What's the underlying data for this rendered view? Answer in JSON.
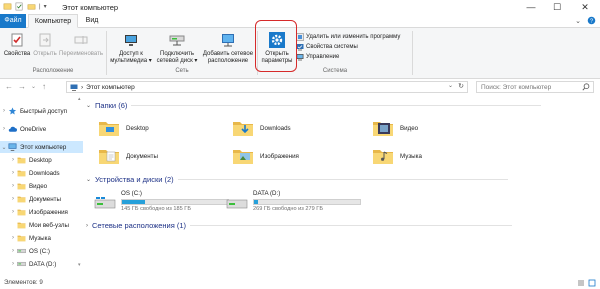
{
  "window": {
    "title": "Этот компьютер",
    "minimize": "—",
    "maximize": "☐",
    "close": "✕"
  },
  "ribbon_tabs": {
    "file": "Файл",
    "computer": "Компьютер",
    "view": "Вид"
  },
  "ribbon": {
    "location_group": {
      "label": "Расположение",
      "properties": "Свойства",
      "open": "Открыть",
      "rename": "Переименовать"
    },
    "network_group": {
      "label": "Сеть",
      "media_access_line1": "Доступ к",
      "media_access_line2": "мультимедиа ▾",
      "map_drive_line1": "Подключить",
      "map_drive_line2": "сетевой диск ▾",
      "add_location_line1": "Добавить сетевое",
      "add_location_line2": "расположение"
    },
    "system_group": {
      "label": "Система",
      "open_settings_line1": "Открыть",
      "open_settings_line2": "параметры",
      "uninstall": "Удалить или изменить программу",
      "system_properties": "Свойства системы",
      "manage": "Управление"
    }
  },
  "address_bar": {
    "path_root": "›",
    "path": "Этот компьютер",
    "search_placeholder": "Поиск: Этот компьютер"
  },
  "navigation_pane": {
    "items": [
      {
        "label": "Быстрый доступ",
        "icon": "star-icon",
        "expand": "›"
      },
      {
        "label": "OneDrive",
        "icon": "cloud-icon",
        "expand": "›"
      },
      {
        "label": "Этот компьютер",
        "icon": "computer-icon",
        "expand": "⌄"
      },
      {
        "label": "Desktop",
        "icon": "desktop-folder-icon",
        "expand": "›"
      },
      {
        "label": "Downloads",
        "icon": "downloads-folder-icon",
        "expand": "›"
      },
      {
        "label": "Видео",
        "icon": "video-folder-icon",
        "expand": "›"
      },
      {
        "label": "Документы",
        "icon": "documents-folder-icon",
        "expand": "›"
      },
      {
        "label": "Изображения",
        "icon": "pictures-folder-icon",
        "expand": "›"
      },
      {
        "label": "Мои веб-узлы",
        "icon": "web-folder-icon",
        "expand": ""
      },
      {
        "label": "Музыка",
        "icon": "music-folder-icon",
        "expand": "›"
      },
      {
        "label": "OS (C:)",
        "icon": "drive-icon",
        "expand": "›"
      },
      {
        "label": "DATA (D:)",
        "icon": "drive-icon",
        "expand": "›"
      }
    ]
  },
  "content": {
    "folders_header": "Папки (6)",
    "folders": [
      {
        "label": "Desktop",
        "icon": "desktop-folder-icon"
      },
      {
        "label": "Downloads",
        "icon": "downloads-folder-icon"
      },
      {
        "label": "Видео",
        "icon": "video-folder-icon"
      },
      {
        "label": "Документы",
        "icon": "documents-folder-icon"
      },
      {
        "label": "Изображения",
        "icon": "pictures-folder-icon"
      },
      {
        "label": "Музыка",
        "icon": "music-folder-icon"
      }
    ],
    "drives_header": "Устройства и диски (2)",
    "drives": [
      {
        "label": "OS (C:)",
        "free": "145 ГБ свободно из 185 ГБ",
        "used_fraction": 0.22
      },
      {
        "label": "DATA (D:)",
        "free": "269 ГБ свободно из 279 ГБ",
        "used_fraction": 0.04
      }
    ],
    "network_header": "Сетевые расположения (1)"
  },
  "status_bar": {
    "items_count": "Элементов: 9"
  },
  "colors": {
    "accent": "#1979ca",
    "selection": "#cce8ff",
    "drive_bar": "#26a0da",
    "folder_yellow": "#f8d775",
    "highlight_red": "#d62a2a",
    "section_header": "#1e3287"
  }
}
